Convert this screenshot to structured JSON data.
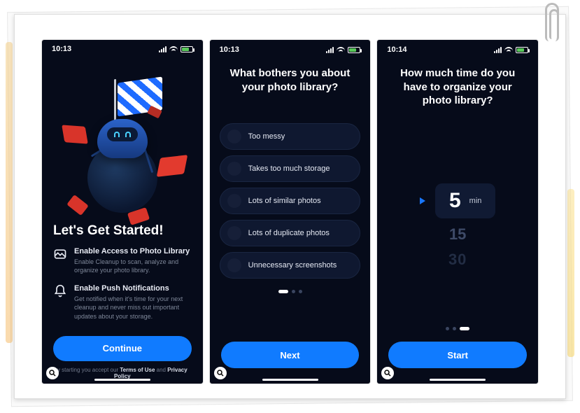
{
  "status": {
    "time_s1": "10:13",
    "time_s2": "10:13",
    "time_s3": "10:14"
  },
  "screen1": {
    "title": "Let's Get Started!",
    "perm1_head": "Enable Access to Photo Library",
    "perm1_sub": "Enable Cleanup to scan, analyze and organize your photo library.",
    "perm2_head": "Enable Push Notifications",
    "perm2_sub": "Get notified when it's time for your next cleanup and never miss out important updates about your storage.",
    "cta": "Continue",
    "legal_pre": "y starting you accept our ",
    "legal_terms": "Terms of Use",
    "legal_and": " and ",
    "legal_privacy": "Privacy Policy"
  },
  "screen2": {
    "question": "What bothers you about your photo library?",
    "opt1": "Too messy",
    "opt2": "Takes too much storage",
    "opt3": "Lots of similar photos",
    "opt4": "Lots of duplicate photos",
    "opt5": "Unnecessary screenshots",
    "cta": "Next"
  },
  "screen3": {
    "question": "How much time do you have to organize your photo library?",
    "selected_value": "5",
    "unit": "min",
    "next1": "15",
    "next2": "30",
    "cta": "Start"
  }
}
